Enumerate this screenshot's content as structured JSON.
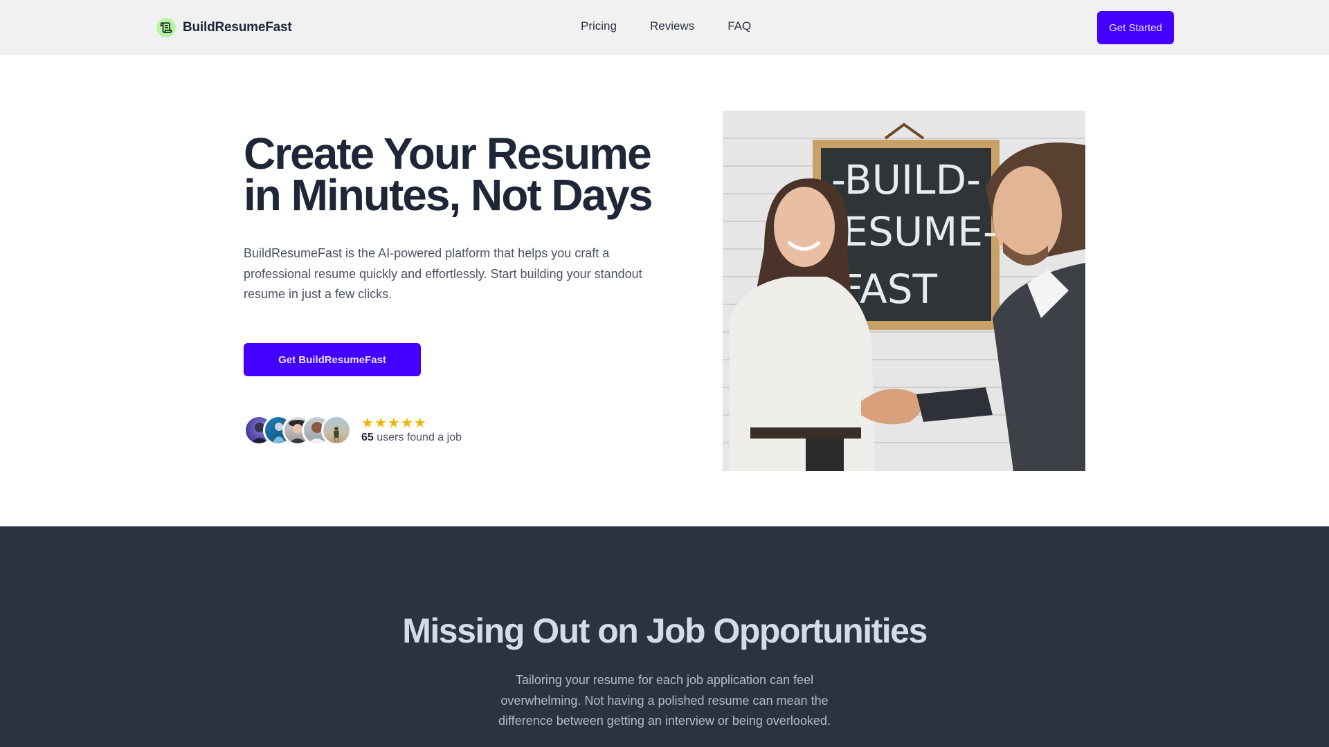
{
  "header": {
    "logo_text": "BuildResumeFast",
    "logo_icon": "scroll-icon",
    "nav": [
      {
        "label": "Pricing"
      },
      {
        "label": "Reviews"
      },
      {
        "label": "FAQ"
      }
    ],
    "cta_label": "Get Started"
  },
  "hero": {
    "title_line1": "Create Your Resume",
    "title_line2": "in Minutes, Not Days",
    "description": "BuildResumeFast is the AI-powered platform that helps you craft a professional resume quickly and effortlessly. Start building your standout resume in just a few clicks.",
    "cta_label": "Get BuildResumeFast",
    "social_proof": {
      "avatar_count": 5,
      "rating_stars": 5,
      "star_glyph": "★",
      "user_count": "65",
      "user_text": " users found a job"
    },
    "image": {
      "alt": "Woman and man shaking hands in front of a chalkboard reading BUILD RESUME FAST",
      "chalkboard_lines": [
        "-BUILD-",
        "RESUME-",
        "FAST"
      ]
    }
  },
  "problem_section": {
    "title": "Missing Out on Job Opportunities",
    "description": "Tailoring your resume for each job application can feel overwhelming. Not having a polished resume can mean the difference between getting an interview or being overlooked."
  },
  "colors": {
    "brand_primary": "#4400ff",
    "header_bg": "#f1f1f1",
    "logo_badge": "#b6f5a6",
    "star": "#f2b400",
    "dark_section_bg": "#2d3241",
    "heading_text": "#1f2638"
  }
}
